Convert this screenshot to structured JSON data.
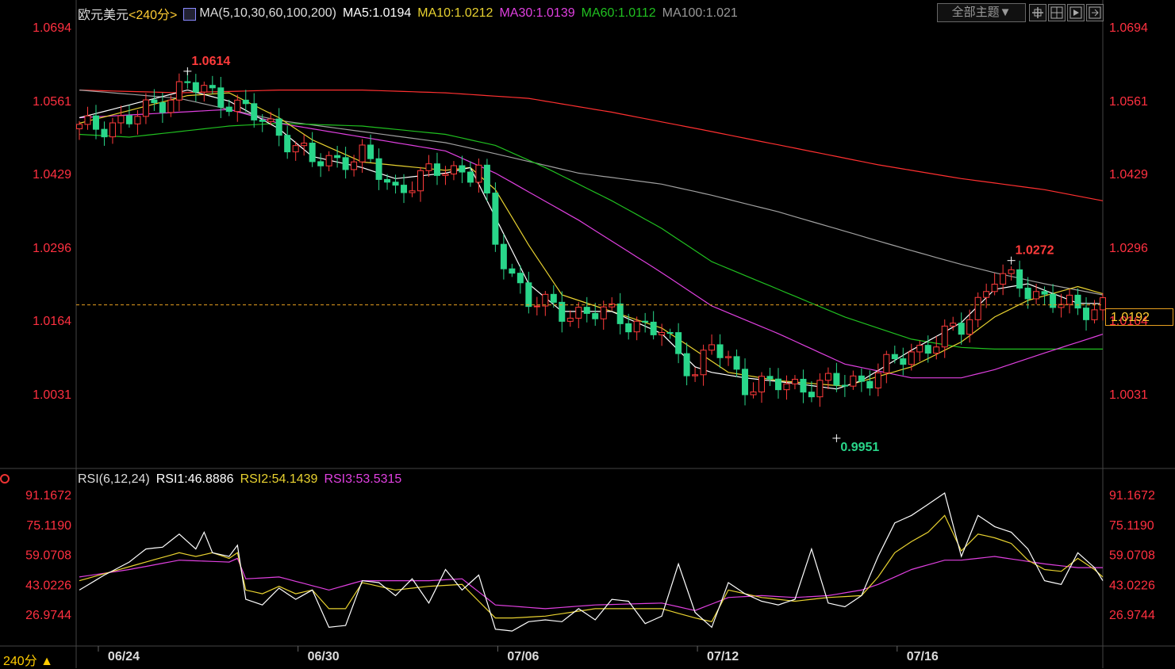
{
  "header": {
    "symbol": "欧元美元",
    "period_link": "<240分>",
    "ma_title": "MA(5,10,30,60,100,200)",
    "ma5": "MA5:1.0194",
    "ma10": "MA10:1.0212",
    "ma30": "MA30:1.0139",
    "ma60": "MA60:1.0112",
    "ma100": "MA100:1.021",
    "theme_button": "全部主题▼"
  },
  "rsi_header": {
    "title": "RSI(6,12,24)",
    "rsi1": "RSI1:46.8886",
    "rsi2": "RSI2:54.1439",
    "rsi3": "RSI3:53.5315"
  },
  "footer": {
    "period": "240分 ▲"
  },
  "current_price": "1.0192",
  "colors": {
    "up": "#ff3b3b",
    "down": "#29d68a",
    "ma5": "#ffffff",
    "ma10": "#e8d230",
    "ma30": "#e040e0",
    "ma60": "#20c020",
    "ma100": "#a0a0a0",
    "ma200": "#ff3030",
    "axis_text": "#ff3040"
  },
  "chart_data": [
    {
      "type": "candlestick",
      "title": "欧元美元",
      "price_ticks": [
        "1.0694",
        "1.0561",
        "1.0429",
        "1.0296",
        "1.0164",
        "1.0031"
      ],
      "ylim": [
        0.9935,
        1.0694
      ],
      "x_tick_labels": [
        "06/24",
        "06/30",
        "07/06",
        "07/12",
        "07/16"
      ],
      "x_tick_index": [
        4,
        28,
        52,
        76,
        100
      ],
      "annotations": [
        {
          "text": "1.0614",
          "index": 13,
          "value": 1.0614
        },
        {
          "text": "1.0272",
          "index": 112,
          "value": 1.0272
        },
        {
          "text": "0.9951",
          "index": 91,
          "value": 0.9951
        }
      ],
      "close_sample_index": [
        0,
        6,
        13,
        18,
        24,
        28,
        34,
        38,
        44,
        47,
        48,
        50,
        54,
        58,
        64,
        70,
        74,
        76,
        80,
        86,
        91,
        94,
        100,
        106,
        110,
        114,
        120,
        123
      ],
      "close_sample": [
        1.051,
        1.0525,
        1.059,
        1.056,
        1.0505,
        1.045,
        1.046,
        1.04,
        1.044,
        1.043,
        1.044,
        1.03,
        1.02,
        1.018,
        1.0175,
        1.014,
        1.007,
        1.012,
        1.005,
        1.0045,
        1.005,
        1.0055,
        1.0105,
        1.015,
        1.0245,
        1.022,
        1.018,
        1.0195
      ],
      "ma_lines": [
        {
          "name": "MA5",
          "color": "#ffffff",
          "index": [
            0,
            13,
            18,
            24,
            28,
            34,
            38,
            44,
            47,
            50,
            54,
            58,
            64,
            70,
            74,
            76,
            80,
            86,
            91,
            94,
            100,
            106,
            110,
            114,
            120,
            123
          ],
          "values": [
            1.053,
            1.058,
            1.056,
            1.051,
            1.046,
            1.044,
            1.042,
            1.043,
            1.044,
            1.035,
            1.023,
            1.018,
            1.018,
            1.014,
            1.008,
            1.007,
            1.006,
            1.005,
            1.004,
            1.0055,
            1.011,
            1.016,
            1.022,
            1.023,
            1.0195,
            1.0194
          ]
        },
        {
          "name": "MA10",
          "color": "#e8d230",
          "index": [
            0,
            13,
            18,
            24,
            28,
            34,
            44,
            47,
            50,
            54,
            58,
            64,
            70,
            74,
            78,
            84,
            92,
            100,
            106,
            110,
            114,
            120,
            123
          ],
          "values": [
            1.052,
            1.057,
            1.0575,
            1.053,
            1.049,
            1.045,
            1.0435,
            1.044,
            1.04,
            1.03,
            1.021,
            1.018,
            1.015,
            1.011,
            1.007,
            1.0055,
            1.0045,
            1.008,
            1.0125,
            1.017,
            1.02,
            1.0225,
            1.0212
          ]
        },
        {
          "name": "MA30",
          "color": "#e040e0",
          "index": [
            0,
            12,
            18,
            24,
            34,
            44,
            50,
            60,
            70,
            76,
            84,
            92,
            100,
            106,
            110,
            116,
            123
          ],
          "values": [
            1.053,
            1.054,
            1.0545,
            1.052,
            1.0495,
            1.047,
            1.043,
            1.0345,
            1.025,
            1.019,
            1.014,
            1.0085,
            1.006,
            1.006,
            1.0075,
            1.0105,
            1.0139
          ]
        },
        {
          "name": "MA60",
          "color": "#20c020",
          "index": [
            0,
            6,
            12,
            18,
            24,
            34,
            44,
            50,
            56,
            64,
            70,
            76,
            84,
            92,
            100,
            106,
            110,
            123
          ],
          "values": [
            1.05,
            1.0495,
            1.0505,
            1.0515,
            1.052,
            1.0515,
            1.05,
            1.048,
            1.044,
            1.038,
            1.033,
            1.027,
            1.022,
            1.017,
            1.013,
            1.0115,
            1.0112,
            1.0112
          ]
        },
        {
          "name": "MA100",
          "color": "#a0a0a0",
          "index": [
            0,
            12,
            18,
            24,
            34,
            44,
            50,
            60,
            70,
            76,
            84,
            92,
            100,
            106,
            110,
            116,
            123
          ],
          "values": [
            1.058,
            1.0565,
            1.0545,
            1.0525,
            1.0505,
            1.0485,
            1.0465,
            1.043,
            1.041,
            1.039,
            1.036,
            1.0325,
            1.029,
            1.0265,
            1.025,
            1.023,
            1.021
          ]
        },
        {
          "name": "MA200",
          "color": "#ff3030",
          "index": [
            0,
            12,
            24,
            34,
            44,
            54,
            64,
            76,
            86,
            96,
            106,
            116,
            123
          ],
          "values": [
            1.058,
            1.0575,
            1.058,
            1.058,
            1.0575,
            1.0565,
            1.054,
            1.0505,
            1.0475,
            1.0445,
            1.042,
            1.04,
            1.038
          ]
        }
      ]
    },
    {
      "type": "line",
      "title": "RSI(6,12,24)",
      "y_ticks": [
        "91.1672",
        "75.1190",
        "59.0708",
        "43.0226",
        "26.9744"
      ],
      "ylim": [
        11,
        97
      ],
      "x_tick_labels": [
        "06/24",
        "06/30",
        "07/06",
        "07/12",
        "07/16"
      ],
      "series": [
        {
          "name": "RSI1",
          "color": "#ffffff",
          "index": [
            0,
            3,
            6,
            8,
            10,
            12,
            13,
            14,
            15,
            16,
            18,
            19,
            20,
            22,
            24,
            26,
            28,
            30,
            32,
            34,
            36,
            38,
            40,
            42,
            44,
            46,
            48,
            50,
            52,
            54,
            56,
            58,
            60,
            62,
            64,
            66,
            68,
            70,
            72,
            74,
            76,
            78,
            80,
            82,
            84,
            86,
            88,
            90,
            92,
            94,
            96,
            98,
            100,
            102,
            104,
            106,
            108,
            110,
            112,
            114,
            116,
            118,
            120,
            122,
            123
          ],
          "values": [
            40,
            48,
            55,
            62,
            63,
            70,
            66,
            62,
            71,
            60,
            58,
            64,
            35,
            32,
            41,
            35,
            40,
            20,
            21,
            45,
            44,
            37,
            46,
            33,
            51,
            40,
            48,
            19,
            18,
            23,
            24,
            23,
            30,
            24,
            35,
            34,
            22,
            26,
            54,
            28,
            20,
            44,
            38,
            34,
            32,
            35,
            62,
            33,
            31,
            37,
            58,
            76,
            80,
            86,
            92,
            58,
            80,
            74,
            71,
            62,
            45,
            43,
            60,
            52,
            45
          ]
        },
        {
          "name": "RSI2",
          "color": "#e8d230",
          "index": [
            0,
            4,
            8,
            12,
            14,
            16,
            18,
            19,
            20,
            22,
            24,
            26,
            28,
            30,
            32,
            34,
            38,
            42,
            46,
            50,
            52,
            56,
            62,
            66,
            70,
            74,
            76,
            78,
            82,
            86,
            90,
            94,
            96,
            98,
            100,
            102,
            104,
            106,
            108,
            110,
            112,
            114,
            116,
            118,
            120,
            122,
            123
          ],
          "values": [
            45,
            50,
            55,
            60,
            58,
            60,
            57,
            60,
            40,
            38,
            42,
            38,
            40,
            30,
            30,
            44,
            40,
            42,
            43,
            25,
            25,
            26,
            30,
            30,
            30,
            25,
            23,
            40,
            36,
            34,
            36,
            37,
            47,
            60,
            66,
            71,
            80,
            61,
            70,
            68,
            65,
            56,
            51,
            50,
            57,
            51,
            47
          ]
        },
        {
          "name": "RSI3",
          "color": "#e040e0",
          "index": [
            0,
            6,
            12,
            18,
            19,
            20,
            24,
            30,
            34,
            42,
            46,
            50,
            56,
            62,
            70,
            74,
            78,
            82,
            86,
            90,
            94,
            96,
            100,
            104,
            106,
            110,
            116,
            120,
            123
          ],
          "values": [
            47,
            51,
            56,
            55,
            57,
            46,
            47,
            40,
            45,
            45,
            46,
            32,
            30,
            32,
            33,
            29,
            36,
            37,
            36,
            37,
            40,
            43,
            51,
            56,
            56,
            58,
            54,
            52,
            52
          ]
        }
      ]
    }
  ]
}
